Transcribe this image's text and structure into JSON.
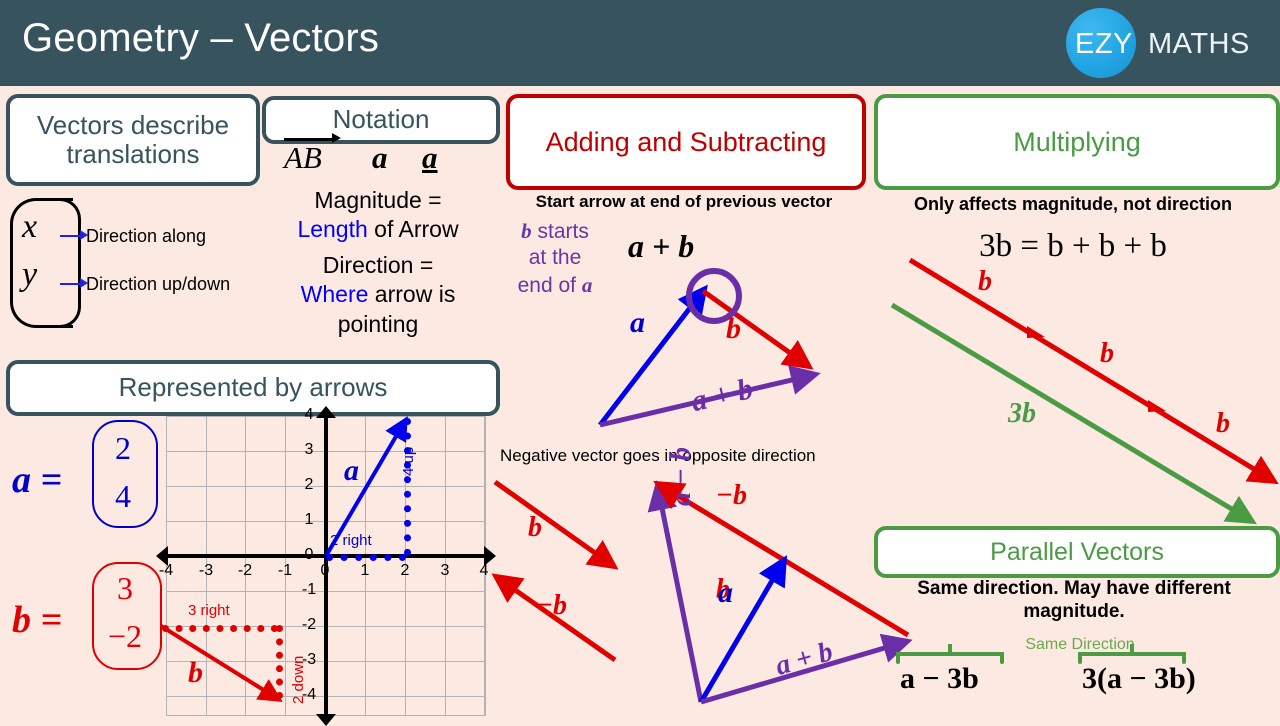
{
  "header": {
    "title": "Geometry – Vectors",
    "logo_ezy": "EZY",
    "logo_maths": "MATHS"
  },
  "boxes": {
    "describe": "Vectors describe translations",
    "notation": "Notation",
    "arrows": "Represented by arrows",
    "addsub": "Adding and Subtracting",
    "multiplying": "Multiplying",
    "parallel": "Parallel Vectors"
  },
  "notation": {
    "ab": "AB",
    "a_bold": "a",
    "a_underline": "a",
    "magnitude_line1": "Magnitude =",
    "magnitude_blue": "Length",
    "magnitude_rest": " of Arrow",
    "direction_line1": "Direction =",
    "direction_blue": "Where",
    "direction_rest": " arrow is pointing"
  },
  "xy": {
    "x": "x",
    "y": "y",
    "x_label": "Direction along",
    "y_label": "Direction up/down"
  },
  "vectors": {
    "a_label": "a =",
    "a_x": "2",
    "a_y": "4",
    "b_label": "b =",
    "b_x": "3",
    "b_y": "−2"
  },
  "graph": {
    "x_ticks": [
      "-4",
      "-3",
      "-2",
      "-1",
      "0",
      "1",
      "2",
      "3",
      "4"
    ],
    "y_ticks": [
      "4",
      "3",
      "2",
      "1",
      "0",
      "-1",
      "-2",
      "-3",
      "-4"
    ],
    "a_name": "a",
    "b_name": "b",
    "a_right_label": "2 right",
    "a_up_label": "4 up",
    "b_right_label": "3 right",
    "b_down_label": "2 down"
  },
  "addsub": {
    "note": "Start arrow at end of previous vector",
    "b_starts": "b starts at the end of a",
    "b_starts_1": "b",
    "b_starts_2": " starts",
    "b_starts_3": "at the",
    "b_starts_4": "end of ",
    "b_starts_5": "a",
    "title_expr": "a + b",
    "lbl_a": "a",
    "lbl_b": "b",
    "lbl_apb": "a + b",
    "neg_note": "Negative vector goes in opposite direction",
    "lbl_b2": "b",
    "lbl_negb": "−b",
    "lbl_negb2": "−b",
    "lbl_a2": "a",
    "lbl_b3": "b",
    "lbl_amb": "a − b",
    "lbl_apb2": "a + b"
  },
  "multiplying": {
    "note": "Only affects magnitude, not direction",
    "equation": "3b = b + b + b",
    "lbl_b1": "b",
    "lbl_b2": "b",
    "lbl_b3": "b",
    "lbl_3b": "3b"
  },
  "parallel": {
    "note": "Same direction. May have different magnitude.",
    "same_direction": "Same Direction",
    "expr1": "a − 3b",
    "expr2": "3(a − 3b)"
  },
  "colors": {
    "header_bg": "#37535e",
    "page_bg": "#fceae2",
    "blue": "#0000cc",
    "red": "#e00000",
    "purple": "#6a2fa8",
    "green": "#4a9b43",
    "logo_blue": "#22a5e3"
  }
}
